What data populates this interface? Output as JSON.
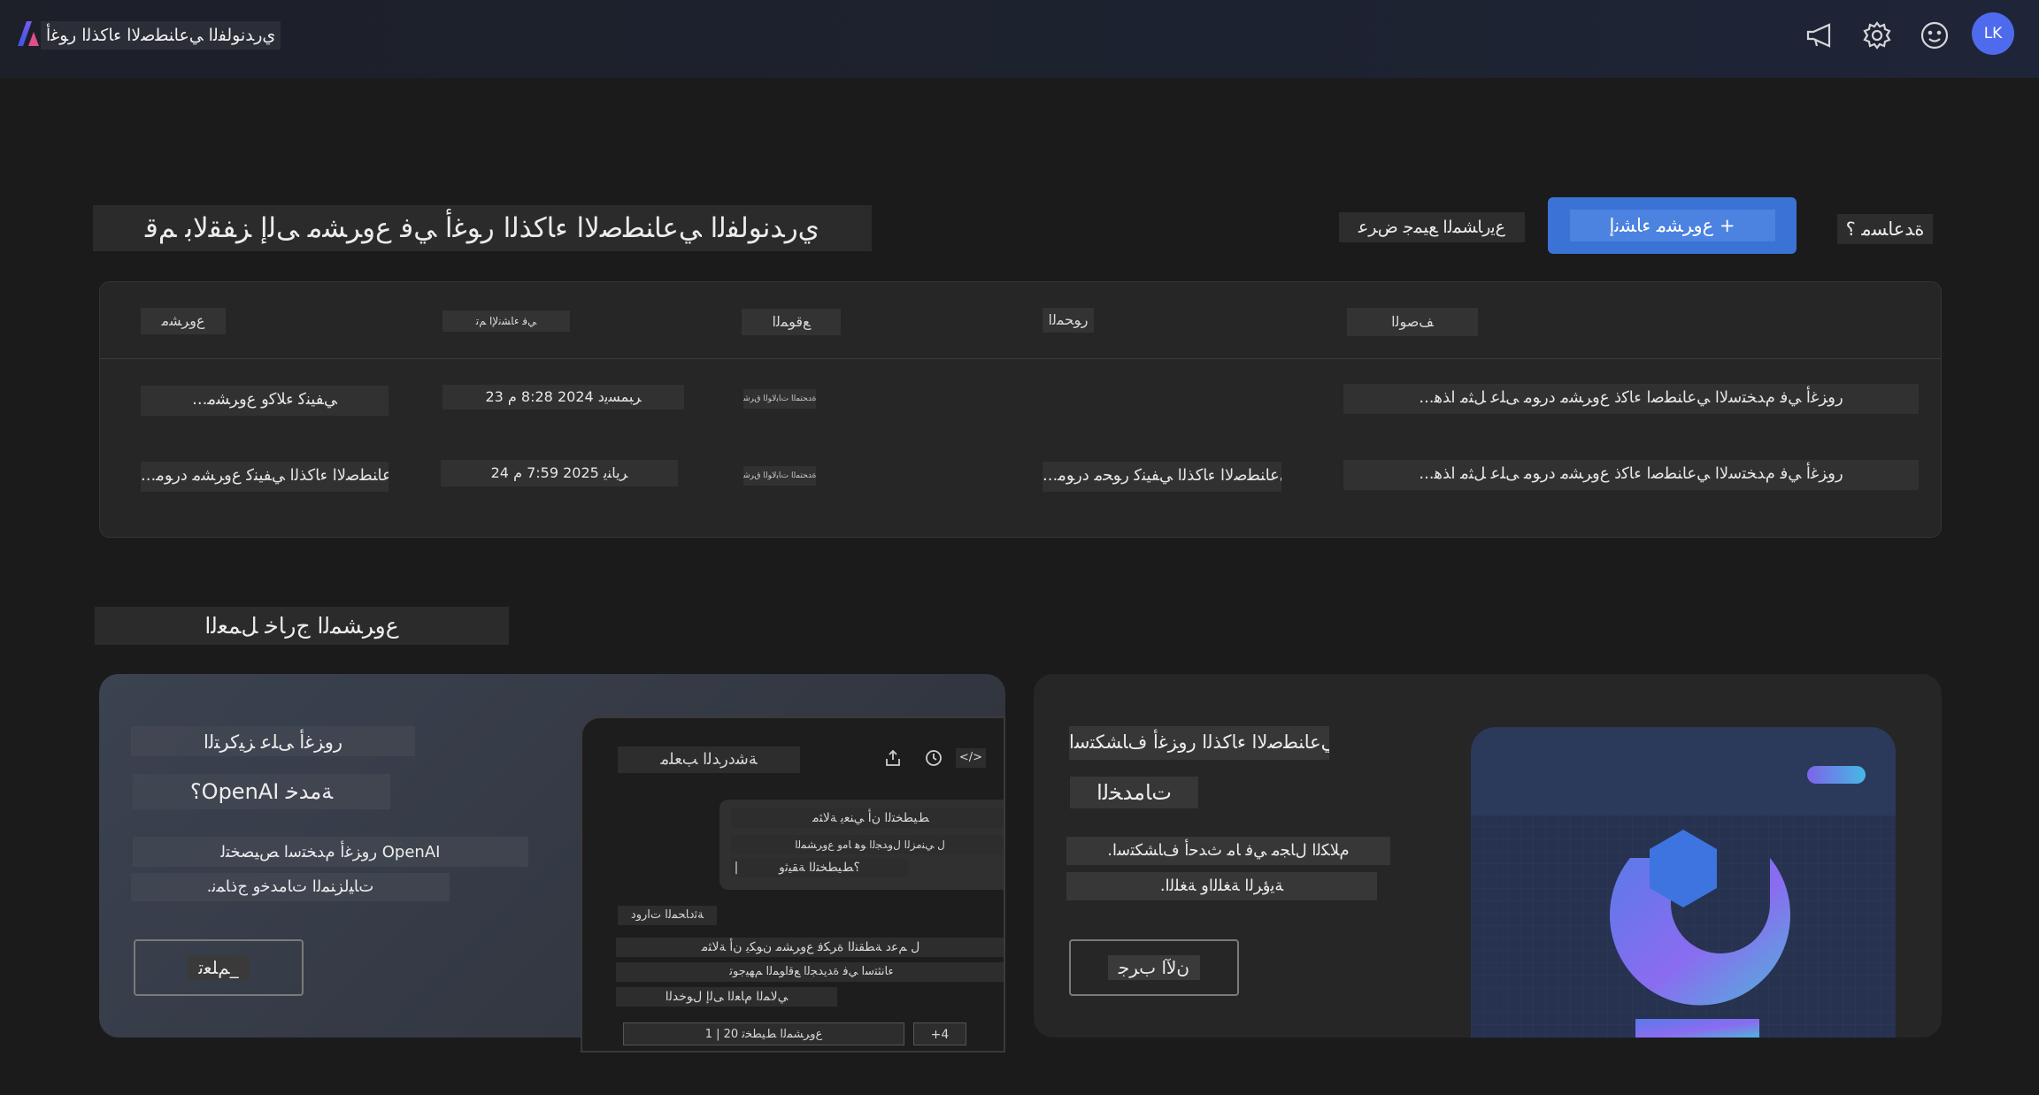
{
  "topbar": {
    "app_title": "ﻱﺭﺪﻧﻮﻟﻔﻟﺍ ﻲﻋﺎﻨﻄﺻﻻﺍ ءﺎﻛﺬﻟﺍ ﺭﻮﻏﺃ",
    "avatar_initials": "LK",
    "icons": [
      "megaphone-icon",
      "gear-icon",
      "smiley-icon"
    ]
  },
  "header": {
    "title": "ﻱﺭﺪﻧﻮﻟﻔﻟﺍ ﻲﻋﺎﻨﻄﺻﻻﺍ ءﺎﻛﺬﻟﺍ ﺭﻮﻏﺃ ﻲﻓ ﻉﻭﺮﺸﻣ ﻰﻟﺇ ﺰﻔﻘﻟﺎﺑ ﻢﻗ",
    "help_label": "ﺓﺪﻋﺎﺴﻣ ؟",
    "new_project_label": "ﻉﻭﺮﺸﻣ ءﺎﺸﻧﺇ +",
    "view_all_label": "ﻉﻳﺭﺎﺸﻤﻟﺍ ﻊﻴﻤﺟ ﺽﺮﻋ"
  },
  "table": {
    "columns": {
      "project": "ﻉﻭﺮﺸﻣ",
      "created": "ﻲﻓ ءﺎﺸﻧﻹﺍ ﻢﺗ",
      "location": "ﻊﻗﻮﻤﻟﺍ",
      "resource": "ﺭﻮﺤﻤﻟﺍ",
      "description": "ﻒﺻﻮﻟﺍ"
    },
    "rows": [
      {
        "project": "...ﻲﻔﻴﻨﻛ ءﻼﻛﻭ ﻉﻭﺮﺸﻣ",
        "created": "23 ﺮﺒﻤﺴﻳﺩ 2024 8:28 ﻡ",
        "location": "ﺓﺪﺤﺘﻤﻟﺍ ﺕﺎﻳﻻﻮﻟﺍ ﻕﺮﺷ",
        "resource": "",
        "description": "...ﺭﻭﺰﻏﺃ ﻲﻓ ﻡﺪﺨﺘﺳﻻﺍ ﻲﻋﺎﻨﻄﺻﺍ ءﺎﻛﺫ ﻉﻭﺮﺸﻣ ﺩﺭﻮﻣ ﻰﻠﻋ ﻞﺜﻣ ﺍﺬﻫ"
      },
      {
        "project": "...ﻲﻋﺎﻨﻄﺻﻻﺍ ءﺎﻛﺬﻟﺍ ﻲﻔﻴﻨﻛ ﻉﻭﺮﺸﻣ ﺩﺭﻮﻣ",
        "created": "24 ﺮﻳﺎﻨﻳ 2025 7:59 ﻡ",
        "location": "ﺓﺪﺤﺘﻤﻟﺍ ﺕﺎﻳﻻﻮﻟﺍ ﻕﺮﺷ",
        "resource": "...ﻲﻋﺎﻨﻄﺻﻻﺍ ءﺎﻛﺬﻟﺍ ﻲﻔﻴﻨﻛ ﺭﻮﺤﻣ ﺩﺭﻮﻣ",
        "description": "...ﺭﻭﺰﻏﺃ ﻲﻓ ﻡﺪﺨﺘﺳﻻﺍ ﻲﻋﺎﻨﻄﺻﺍ ءﺎﻛﺫ ﻉﻭﺮﺸﻣ ﺩﺭﻮﻣ ﻰﻠﻋ ﻞﺜﻣ ﺍﺬﻫ"
      }
    ]
  },
  "outside": {
    "title": "ﻉﻭﺮﺸﻤﻟﺍ ﺝﺭﺎﺧ ﻞﻤﻌﻟﺍ",
    "openai_card": {
      "line1": "ﺭﻭﺰﻏﺃ ﻰﻠﻋ ﺰﻴﻛﺮﺘﻟﺍ",
      "line2": "؟OpenAI ﺔﻣﺪﺧ",
      "desc1": "ﺭﻭﺰﻏﺃ ﻡﺪﺨﺘﺳﺍ ﺺﻴﺼﺨﺘﻟ OpenAI",
      "desc2": ".ﺕﺎﻴﻟﺰﻨﻤﻟﺍ ﺕﺎﻣﺪﺧﻭ ﺝﺫﺎﻤﻧ",
      "button": "ﻢﻠﻌﺗ_"
    },
    "preview": {
      "heading": "ﺔﺷﺩﺭﺪﻟﺍ ﺐﻌﻠﻣ",
      "code_icon": "</>",
      "bubble_lines": [
        "ﻂﻴﻄﺨﺘﻟﺍ ﻥﺃ ﻲﻨﻌﻳ ﺔﻟﺎﺜﻣ",
        "ﻝ ﻲﻨﻣﺰﻟﺍ ﻝﻭﺪﺠﻟﺍ ﻮﻫ ﺎﻣﻭ ﻉﻭﺮﺸﻤﻟﺍ",
        "؟ﻂﻴﻄﺨﺘﻟﺍ ﺔﻘﻴﺛﻭ"
      ],
      "cursor": "|",
      "section_label": "ﺔﺛﺩﺎﺤﻤﻟﺍ ﺕﺍﺭﻭﺩ",
      "list_lines": [
        "ﻝ ﻢﻋﺩ ﺔﻄﻘﻨﻟﺍ ﺓﺮﻜﻓ ﻉﻭﺮﺸﻣ ﻥﻮﻜﻳ ﻥﺃ ﺔﻟﺎﺜﻣ",
        "ﺀﺎﻧﺜﺘﺳﺍ ﻲﻓ ﺓﺪﻳﺪﺠﻟﺍ ﻊﻗﺍﻮﻤﻟﺍ ﻢﻬﻴﺟﻮﺗ",
        "ﻲﻟﺎﻤﻟﺍ ﻡﺎﻌﻟﺍ ﻰﻟﺇ ﻝﻮﺧﺪﻟﺍ"
      ],
      "footer_count": "ﻉﻭﺮﺸﻤﻟﺍ ﻂﻴﻄﺨﺗ 20 | 1",
      "plus": "+4"
    },
    "models_card": {
      "line1": "ﻲﻋﺎﻨﻄﺻﻻﺍ ءﺎﻛﺬﻟﺍ ﺭﻭﺰﻏﺃ ﻑﺎﺸﻜﺘﺳﺍ",
      "line2": "ﺕﺎﻣﺪﺨﻟﺍ",
      "desc1": ".ﻡﻼﻜﻟﺍ ﻝﺎﺠﻣ ﻲﻓ ﺎﻣ ﺙﺪﺣﺃ ﻑﺎﺸﻜﺘﺳﺍ",
      "desc2": ".ﺔﻳﺅﺮﻟﺍ ﺔﻐﻠﻟﺍﻭ ﺔﻐﻠﻟﺍ",
      "button": "ﻥﻵﺍ ﺏﺮﺟ"
    }
  },
  "colors": {
    "accent": "#3b72d6",
    "avatar": "#4f6bed",
    "background": "#1b1b1b"
  }
}
